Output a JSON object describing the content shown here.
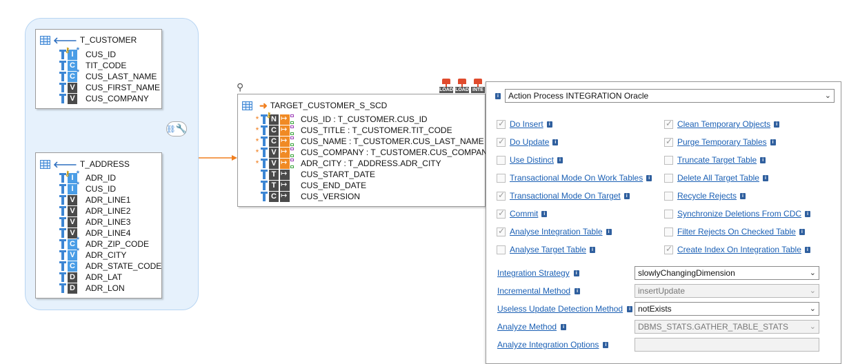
{
  "t_customer": {
    "name": "T_CUSTOMER",
    "columns": [
      {
        "name": "CUS_ID",
        "type": "I"
      },
      {
        "name": "TIT_CODE",
        "type": "C"
      },
      {
        "name": "CUS_LAST_NAME",
        "type": "C"
      },
      {
        "name": "CUS_FIRST_NAME",
        "type": "V"
      },
      {
        "name": "CUS_COMPANY",
        "type": "V"
      }
    ]
  },
  "t_address": {
    "name": "T_ADDRESS",
    "columns": [
      {
        "name": "ADR_ID",
        "type": "I"
      },
      {
        "name": "CUS_ID",
        "type": "I"
      },
      {
        "name": "ADR_LINE1",
        "type": "V"
      },
      {
        "name": "ADR_LINE2",
        "type": "V"
      },
      {
        "name": "ADR_LINE3",
        "type": "V"
      },
      {
        "name": "ADR_LINE4",
        "type": "V"
      },
      {
        "name": "ADR_ZIP_CODE",
        "type": "C"
      },
      {
        "name": "ADR_CITY",
        "type": "V"
      },
      {
        "name": "ADR_STATE_CODE",
        "type": "C"
      },
      {
        "name": "ADR_LAT",
        "type": "D"
      },
      {
        "name": "ADR_LON",
        "type": "D"
      }
    ]
  },
  "target": {
    "name": "TARGET_CUSTOMER_S_SCD",
    "columns": [
      {
        "text": "CUS_ID : T_CUSTOMER.CUS_ID",
        "type": "N"
      },
      {
        "text": "CUS_TITLE : T_CUSTOMER.TIT_CODE",
        "type": "C"
      },
      {
        "text": "CUS_NAME : T_CUSTOMER.CUS_LAST_NAME",
        "type": "C"
      },
      {
        "text": "CUS_COMPANY : T_CUSTOMER.CUS_COMPANY",
        "type": "V"
      },
      {
        "text": "ADR_CITY : T_ADDRESS.ADR_CITY",
        "type": "V"
      },
      {
        "text": "CUS_START_DATE",
        "type": "T"
      },
      {
        "text": "CUS_END_DATE",
        "type": "T"
      },
      {
        "text": "CUS_VERSION",
        "type": "C"
      }
    ],
    "tags": [
      "LOAD",
      "LOAD",
      "INTE"
    ]
  },
  "panel": {
    "process": "Action Process INTEGRATION Oracle",
    "left_options": [
      {
        "label": "Do Insert",
        "checked": true
      },
      {
        "label": "Do Update",
        "checked": true
      },
      {
        "label": "Use Distinct",
        "checked": false
      },
      {
        "label": "Transactional Mode On Work Tables",
        "checked": false
      },
      {
        "label": "Transactional Mode On Target",
        "checked": true
      },
      {
        "label": "Commit",
        "checked": true
      },
      {
        "label": "Analyse Integration Table",
        "checked": true
      },
      {
        "label": "Analyse Target Table",
        "checked": false
      }
    ],
    "right_options": [
      {
        "label": "Clean Temporary Objects",
        "checked": true
      },
      {
        "label": "Purge Temporary Tables",
        "checked": true
      },
      {
        "label": "Truncate Target Table",
        "checked": false
      },
      {
        "label": "Delete All Target Table",
        "checked": false
      },
      {
        "label": "Recycle Rejects",
        "checked": false
      },
      {
        "label": "Synchronize Deletions From CDC",
        "checked": false
      },
      {
        "label": "Filter Rejects On Checked Table",
        "checked": false
      },
      {
        "label": "Create Index On Integration Table",
        "checked": true
      }
    ],
    "fields": [
      {
        "label": "Integration Strategy",
        "value": "slowlyChangingDimension",
        "disabled": false,
        "dropdown": true
      },
      {
        "label": "Incremental Method",
        "value": "insertUpdate",
        "disabled": true,
        "dropdown": true
      },
      {
        "label": "Useless Update Detection Method",
        "value": "notExists",
        "disabled": false,
        "dropdown": true
      },
      {
        "label": "Analyze Method",
        "value": "DBMS_STATS.GATHER_TABLE_STATS",
        "disabled": true,
        "dropdown": true
      },
      {
        "label": "Analyze Integration Options",
        "value": "",
        "disabled": true,
        "dropdown": false
      }
    ]
  },
  "colors": {
    "accent_blue": "#4a9de6",
    "dark_badge": "#4a4a4a",
    "orange": "#f07f1f",
    "link": "#1a5fb4",
    "group_fill": "#e6f1fc"
  }
}
